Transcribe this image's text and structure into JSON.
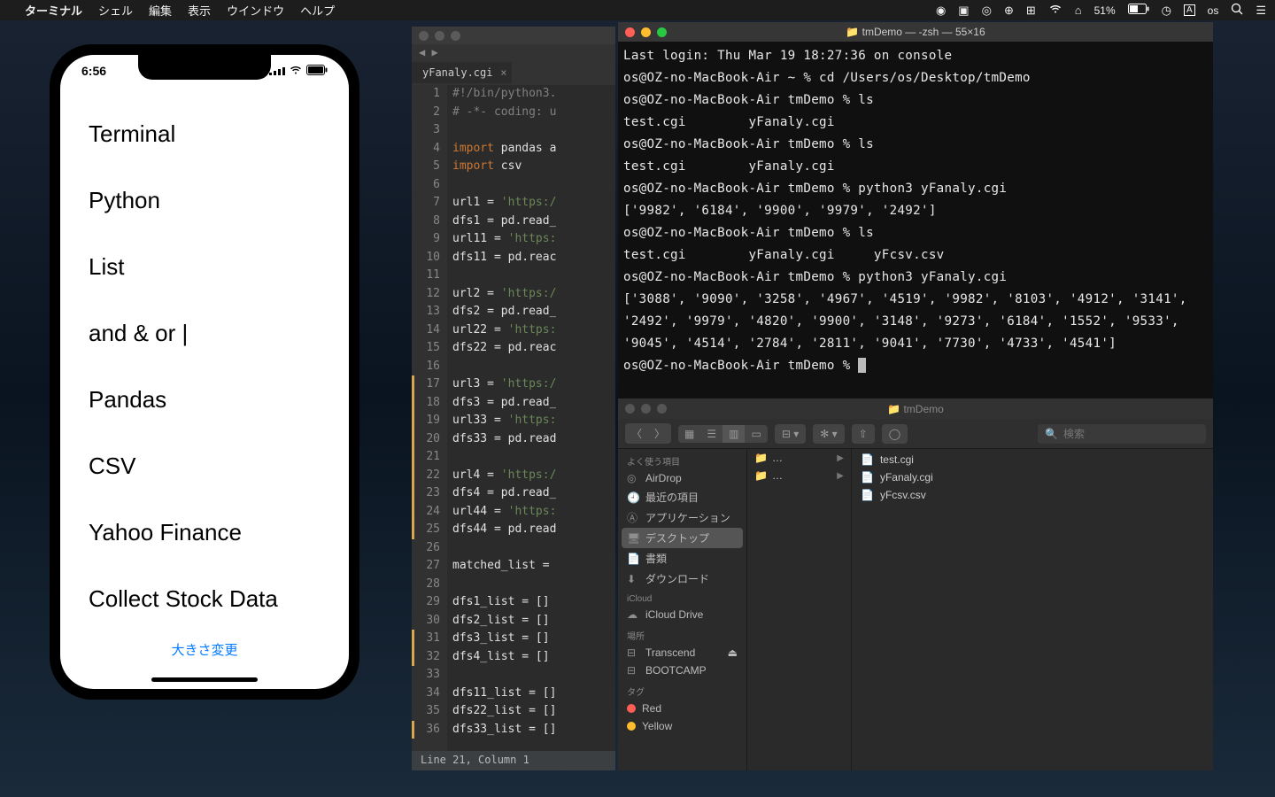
{
  "menubar": {
    "app": "ターミナル",
    "items": [
      "シェル",
      "編集",
      "表示",
      "ウインドウ",
      "ヘルプ"
    ],
    "battery": "51%",
    "user": "os"
  },
  "phone": {
    "time": "6:56",
    "rows": [
      "Terminal",
      "Python",
      "List",
      "and & or |",
      "Pandas",
      "CSV",
      "Yahoo Finance",
      "Collect Stock Data"
    ],
    "bottom_link": "大きさ変更"
  },
  "editor": {
    "tab": "yFanaly.cgi",
    "status": "Line 21, Column 1",
    "lines": [
      {
        "n": 1,
        "m": false,
        "h": "<span class='tok-c'>#!/bin/python3.</span>"
      },
      {
        "n": 2,
        "m": false,
        "h": "<span class='tok-c'># -*- coding: u</span>"
      },
      {
        "n": 3,
        "m": false,
        "h": ""
      },
      {
        "n": 4,
        "m": false,
        "h": "<span class='tok-k'>import</span> pandas a"
      },
      {
        "n": 5,
        "m": false,
        "h": "<span class='tok-k'>import</span> csv"
      },
      {
        "n": 6,
        "m": false,
        "h": ""
      },
      {
        "n": 7,
        "m": false,
        "h": "url1 = <span class='tok-s'>'https:/</span>"
      },
      {
        "n": 8,
        "m": false,
        "h": "dfs1 = pd.read_"
      },
      {
        "n": 9,
        "m": false,
        "h": "url11 = <span class='tok-s'>'https:</span>"
      },
      {
        "n": 10,
        "m": false,
        "h": "dfs11 = pd.reac"
      },
      {
        "n": 11,
        "m": false,
        "h": ""
      },
      {
        "n": 12,
        "m": false,
        "h": "url2 = <span class='tok-s'>'https:/</span>"
      },
      {
        "n": 13,
        "m": false,
        "h": "dfs2 = pd.read_"
      },
      {
        "n": 14,
        "m": false,
        "h": "url22 = <span class='tok-s'>'https:</span>"
      },
      {
        "n": 15,
        "m": false,
        "h": "dfs22 = pd.reac"
      },
      {
        "n": 16,
        "m": false,
        "h": ""
      },
      {
        "n": 17,
        "m": true,
        "h": "url3 = <span class='tok-s'>'https:/</span>"
      },
      {
        "n": 18,
        "m": true,
        "h": "dfs3 = pd.read_"
      },
      {
        "n": 19,
        "m": true,
        "h": "url33 = <span class='tok-s'>'https:</span>"
      },
      {
        "n": 20,
        "m": true,
        "h": "dfs33 = pd.read"
      },
      {
        "n": 21,
        "m": true,
        "h": ""
      },
      {
        "n": 22,
        "m": true,
        "h": "url4 = <span class='tok-s'>'https:/</span>"
      },
      {
        "n": 23,
        "m": true,
        "h": "dfs4 = pd.read_"
      },
      {
        "n": 24,
        "m": true,
        "h": "url44 = <span class='tok-s'>'https:</span>"
      },
      {
        "n": 25,
        "m": true,
        "h": "dfs44 = pd.read"
      },
      {
        "n": 26,
        "m": false,
        "h": ""
      },
      {
        "n": 27,
        "m": false,
        "h": "matched_list ="
      },
      {
        "n": 28,
        "m": false,
        "h": ""
      },
      {
        "n": 29,
        "m": false,
        "h": "dfs1_list = []"
      },
      {
        "n": 30,
        "m": false,
        "h": "dfs2_list = []"
      },
      {
        "n": 31,
        "m": true,
        "h": "dfs3_list = []"
      },
      {
        "n": 32,
        "m": true,
        "h": "dfs4_list = []"
      },
      {
        "n": 33,
        "m": false,
        "h": ""
      },
      {
        "n": 34,
        "m": false,
        "h": "dfs11_list = []"
      },
      {
        "n": 35,
        "m": false,
        "h": "dfs22_list = []"
      },
      {
        "n": 36,
        "m": true,
        "h": "dfs33_list = []"
      }
    ]
  },
  "terminal": {
    "title": "tmDemo — -zsh — 55×16",
    "body": "Last login: Thu Mar 19 18:27:36 on console\nos@OZ-no-MacBook-Air ~ % cd /Users/os/Desktop/tmDemo\nos@OZ-no-MacBook-Air tmDemo % ls\ntest.cgi        yFanaly.cgi\nos@OZ-no-MacBook-Air tmDemo % ls\ntest.cgi        yFanaly.cgi\nos@OZ-no-MacBook-Air tmDemo % python3 yFanaly.cgi\n['9982', '6184', '9900', '9979', '2492']\nos@OZ-no-MacBook-Air tmDemo % ls\ntest.cgi        yFanaly.cgi     yFcsv.csv\nos@OZ-no-MacBook-Air tmDemo % python3 yFanaly.cgi\n['3088', '9090', '3258', '4967', '4519', '9982', '8103', '4912', '3141', '2492', '9979', '4820', '9900', '3148', '9273', '6184', '1552', '9533', '9045', '4514', '2784', '2811', '9041', '7730', '4733', '4541']\nos@OZ-no-MacBook-Air tmDemo % "
  },
  "finder": {
    "title": "tmDemo",
    "search_placeholder": "検索",
    "sidebar": {
      "favorites_header": "よく使う項目",
      "favorites": [
        "AirDrop",
        "最近の項目",
        "アプリケーション",
        "デスクトップ",
        "書類",
        "ダウンロード"
      ],
      "icloud_header": "iCloud",
      "icloud": [
        "iCloud Drive"
      ],
      "locations_header": "場所",
      "locations": [
        "Transcend",
        "BOOTCAMP"
      ],
      "tags_header": "タグ",
      "tags": [
        "Red",
        "Yellow"
      ]
    },
    "files": [
      "test.cgi",
      "yFanaly.cgi",
      "yFcsv.csv"
    ]
  }
}
